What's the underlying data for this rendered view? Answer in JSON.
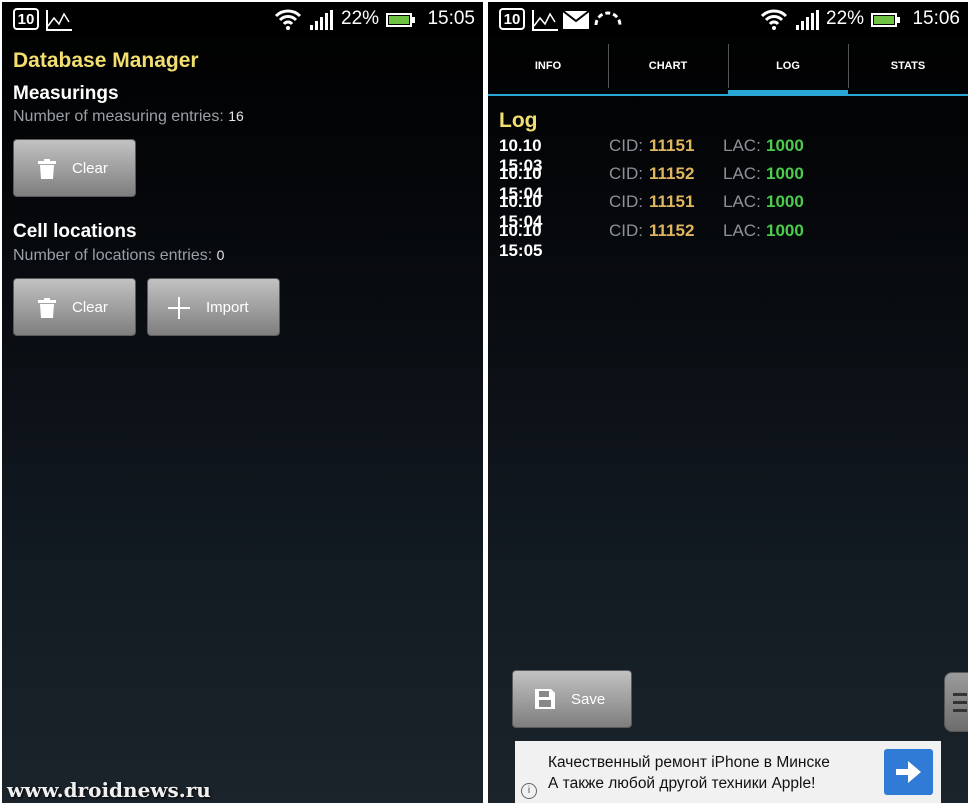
{
  "left": {
    "status": {
      "battery_pct": "22%",
      "time": "15:05",
      "calendar_day": "10"
    },
    "title": "Database Manager",
    "measurings": {
      "heading": "Measurings",
      "count_label": "Number of measuring entries:",
      "count": "16",
      "clear_label": "Clear"
    },
    "cell_locations": {
      "heading": "Cell locations",
      "count_label": "Number of locations entries:",
      "count": "0",
      "clear_label": "Clear",
      "import_label": "Import"
    },
    "watermark": "www.droidnews.ru"
  },
  "right": {
    "status": {
      "battery_pct": "22%",
      "time": "15:06",
      "calendar_day": "10"
    },
    "tabs": [
      {
        "label": "INFO"
      },
      {
        "label": "CHART"
      },
      {
        "label": "LOG"
      },
      {
        "label": "STATS"
      }
    ],
    "active_tab": "LOG",
    "log_title": "Log",
    "cid_label": "CID:",
    "lac_label": "LAC:",
    "rows": [
      {
        "time": "10.10 15:03",
        "cid": "11151",
        "lac": "1000"
      },
      {
        "time": "10.10 15:04",
        "cid": "11152",
        "lac": "1000"
      },
      {
        "time": "10.10 15:04",
        "cid": "11151",
        "lac": "1000"
      },
      {
        "time": "10.10 15:05",
        "cid": "11152",
        "lac": "1000"
      }
    ],
    "save_label": "Save",
    "ad": {
      "line1": "Качественный ремонт iPhone в Минске",
      "line2": "А также любой другой техники Apple!",
      "info_glyph": "i"
    }
  },
  "colors": {
    "accent_yellow": "#f3df6f",
    "tab_blue": "#2aa6d6",
    "cid_color": "#e0b55f",
    "lac_color": "#4ccc4c"
  },
  "icons": [
    "calendar-icon",
    "graph-icon",
    "wifi-icon",
    "signal-icon",
    "battery-icon",
    "mail-icon",
    "sync-icon",
    "trash-icon",
    "plus-icon",
    "save-icon",
    "arrow-right-icon"
  ]
}
